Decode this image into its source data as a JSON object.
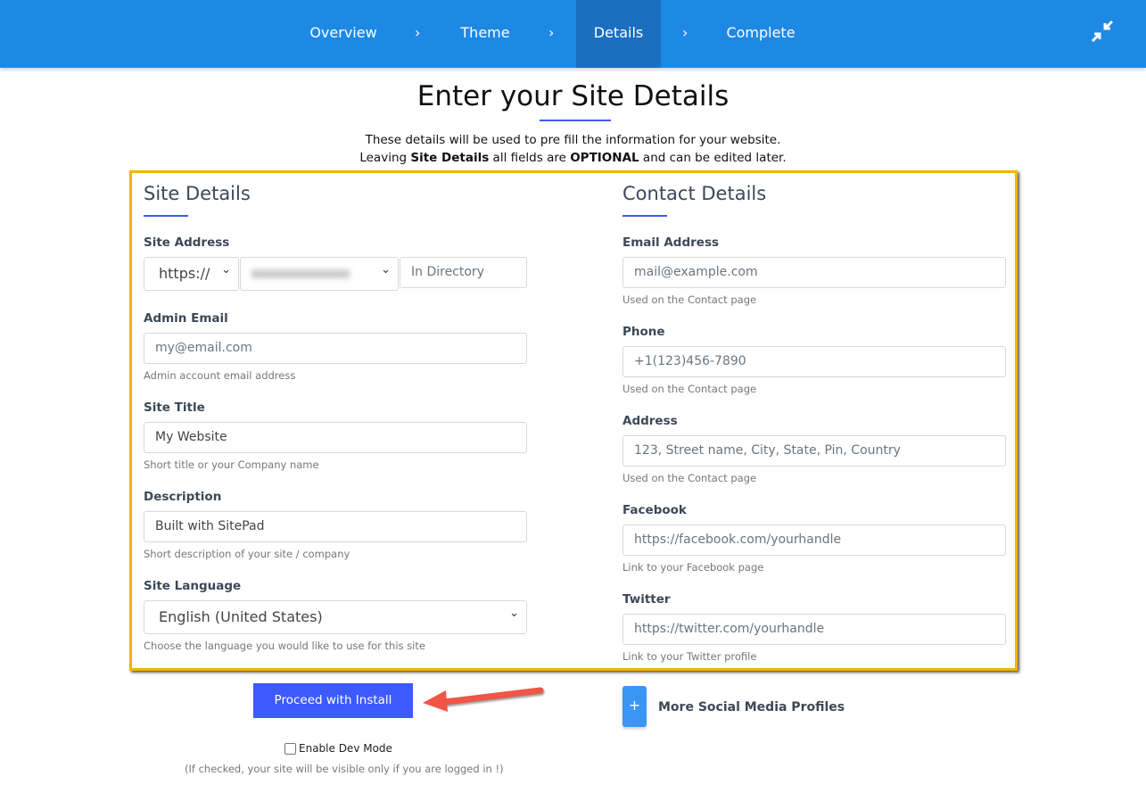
{
  "nav": {
    "steps": [
      {
        "label": "Overview"
      },
      {
        "label": "Theme"
      },
      {
        "label": "Details",
        "active": true
      },
      {
        "label": "Complete"
      }
    ],
    "separator": "›",
    "collapse_icon": "compress-arrows-icon"
  },
  "title": "Enter your Site Details",
  "intro": {
    "line1": "These details will be used to pre fill the information for your website.",
    "line2_a": "Leaving ",
    "line2_b": "Site Details",
    "line2_c": " all fields are ",
    "line2_d": "OPTIONAL",
    "line2_e": " and can be edited later."
  },
  "site": {
    "heading": "Site Details",
    "address_label": "Site Address",
    "protocol": "https://",
    "directory_placeholder": "In Directory",
    "admin_email_label": "Admin Email",
    "admin_email_placeholder": "my@email.com",
    "admin_email_help": "Admin account email address",
    "title_label": "Site Title",
    "title_value": "My Website",
    "title_help": "Short title or your Company name",
    "desc_label": "Description",
    "desc_value": "Built with SitePad",
    "desc_help": "Short description of your site / company",
    "lang_label": "Site Language",
    "lang_value": "English (United States)",
    "lang_help": "Choose the language you would like to use for this site"
  },
  "contact": {
    "heading": "Contact Details",
    "email_label": "Email Address",
    "email_placeholder": "mail@example.com",
    "email_help": "Used on the Contact page",
    "phone_label": "Phone",
    "phone_placeholder": "+1(123)456-7890",
    "phone_help": "Used on the Contact page",
    "address_label": "Address",
    "address_placeholder": "123, Street name, City, State, Pin, Country",
    "address_help": "Used on the Contact page",
    "facebook_label": "Facebook",
    "facebook_placeholder": "https://facebook.com/yourhandle",
    "facebook_help": "Link to your Facebook page",
    "twitter_label": "Twitter",
    "twitter_placeholder": "https://twitter.com/yourhandle",
    "twitter_help": "Link to your Twitter profile"
  },
  "actions": {
    "proceed": "Proceed with Install",
    "more_social": "More Social Media Profiles",
    "plus": "+",
    "dev_mode": "Enable Dev Mode",
    "dev_note": "(If checked, your site will be visible only if you are logged in !)"
  },
  "colors": {
    "header": "#1e88e5",
    "accent": "#3d5afe",
    "highlight": "#f5b400",
    "annotation_arrow": "#f05545"
  }
}
